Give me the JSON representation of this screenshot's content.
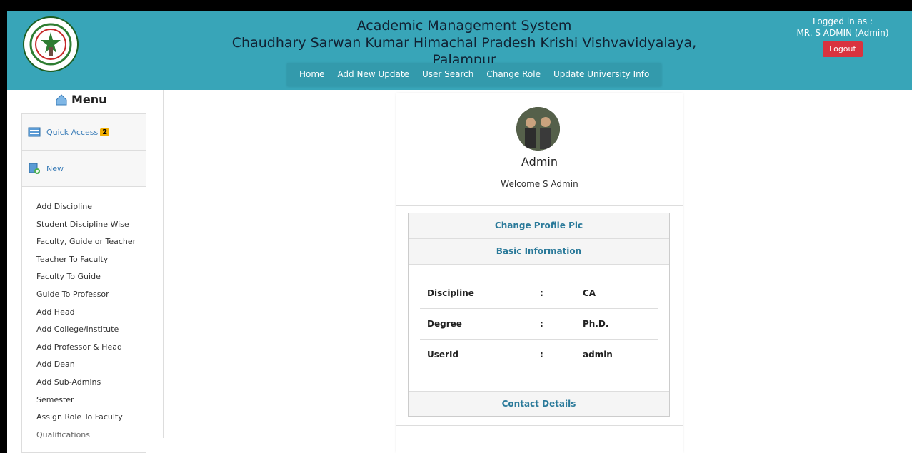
{
  "header": {
    "title_line1": "Academic Management System",
    "title_line2": "Chaudhary Sarwan Kumar Himachal Pradesh Krishi Vishvavidyalaya, Palampur",
    "nav": [
      "Home",
      "Add New Update",
      "User Search",
      "Change Role",
      "Update University Info"
    ],
    "logged_in_label": "Logged in as :",
    "user_name": "MR. S ADMIN (Admin)",
    "logout_label": "Logout",
    "colors": {
      "header_bg": "#38a5b8",
      "logout_bg": "#d9333f"
    }
  },
  "sidebar": {
    "menu_title": "Menu",
    "menu_icon": "home-icon",
    "quick_access_label": "Quick Access",
    "quick_access_count": "2",
    "new_label": "New",
    "items": [
      "Add Discipline",
      "Student Discipline Wise",
      "Faculty, Guide or Teacher",
      "Teacher To Faculty",
      "Faculty To Guide",
      "Guide To Professor",
      "Add Head",
      "Add College/Institute",
      "Add Professor & Head",
      "Add Dean",
      "Add Sub-Admins",
      "Semester",
      "Assign Role To Faculty",
      "Qualifications"
    ]
  },
  "profile": {
    "name": "Admin",
    "welcome": "Welcome S Admin",
    "change_pic_label": "Change Profile Pic",
    "basic_info_label": "Basic Information",
    "contact_label": "Contact Details",
    "fields": [
      {
        "key": "Discipline",
        "sep": ":",
        "value": "CA"
      },
      {
        "key": "Degree",
        "sep": ":",
        "value": "Ph.D."
      },
      {
        "key": "UserId",
        "sep": ":",
        "value": "admin"
      }
    ]
  }
}
